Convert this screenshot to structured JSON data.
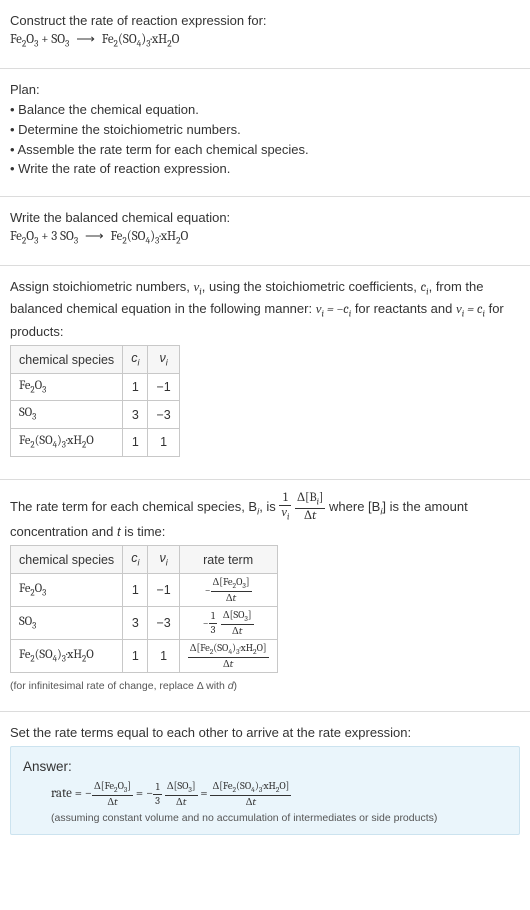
{
  "intro": {
    "prompt": "Construct the rate of reaction expression for:",
    "r_fe2o3": "Fe",
    "r_fe2o3_s1": "2",
    "r_fe2o3_s2": "O",
    "r_fe2o3_s3": "3",
    "r_so3": "SO",
    "r_so3_s": "3",
    "p_fe2so4": "Fe",
    "p_fe2so4_s1": "2",
    "p_fe2so4_s2": "(SO",
    "p_fe2so4_s3": "4",
    "p_fe2so4_s4": ")",
    "p_fe2so4_s5": "3",
    "p_fe2so4_s6": "·xH",
    "p_fe2so4_s7": "2",
    "p_fe2so4_s8": "O"
  },
  "plan": {
    "title": "Plan:",
    "b1": "Balance the chemical equation.",
    "b2": "Determine the stoichiometric numbers.",
    "b3": "Assemble the rate term for each chemical species.",
    "b4": "Write the rate of reaction expression."
  },
  "balanced": {
    "title": "Write the balanced chemical equation:",
    "c1": "Fe",
    "c1a": "2",
    "c1b": "O",
    "c1c": "3",
    "plus": " + 3 SO",
    "c2a": "3",
    "arrow_to": "Fe",
    "p1": "2",
    "p2": "(SO",
    "p3": "4",
    "p4": ")",
    "p5": "3",
    "p6": "·xH",
    "p7": "2",
    "p8": "O"
  },
  "assign": {
    "text_a": "Assign stoichiometric numbers, ",
    "text_b": ", using the stoichiometric coefficients, ",
    "text_c": ", from the balanced chemical equation in the following manner: ",
    "text_d": " for reactants and ",
    "text_e": " for products:",
    "nu": "ν",
    "nu_i": "i",
    "c": "c",
    "c_i": "i",
    "nu_eq_neg": "ν",
    "nu_eq_neg_i": "i",
    "nu_eq_neg_eq": " = −c",
    "nu_eq_neg_ci": "i",
    "nu_eq_pos": "ν",
    "nu_eq_pos_i": "i",
    "nu_eq_pos_eq": " = c",
    "nu_eq_pos_ci": "i"
  },
  "table1": {
    "h1": "chemical species",
    "h2": "c",
    "h2i": "i",
    "h3": "ν",
    "h3i": "i",
    "r1a": "Fe",
    "r1a1": "2",
    "r1a2": "O",
    "r1a3": "3",
    "r1b": "1",
    "r1c": "−1",
    "r2a": "SO",
    "r2a1": "3",
    "r2b": "3",
    "r2c": "−3",
    "r3a": "Fe",
    "r3a1": "2",
    "r3a2": "(SO",
    "r3a3": "4",
    "r3a4": ")",
    "r3a5": "3",
    "r3a6": "·xH",
    "r3a7": "2",
    "r3a8": "O",
    "r3b": "1",
    "r3c": "1"
  },
  "rate_text": {
    "a": "The rate term for each chemical species, B",
    "ai": "i",
    "b": ", is ",
    "c": " where [B",
    "ci": "i",
    "d": "] is the amount concentration and ",
    "t": "t",
    "e": " is time:",
    "f1n": "1",
    "f1d_nu": "ν",
    "f1d_i": "i",
    "f2n_d": "Δ[B",
    "f2n_i": "i",
    "f2n_end": "]",
    "f2d_d": "Δ",
    "f2d_t": "t"
  },
  "table2": {
    "h1": "chemical species",
    "h2": "c",
    "h2i": "i",
    "h3": "ν",
    "h3i": "i",
    "h4": "rate term",
    "r1a": "Fe",
    "r1a1": "2",
    "r1a2": "O",
    "r1a3": "3",
    "r1b": "1",
    "r1c": "−1",
    "r1d_n": "Δ[Fe",
    "r1d_n1": "2",
    "r1d_n2": "O",
    "r1d_n3": "3",
    "r1d_n4": "]",
    "r1d_d": "Δ",
    "r1d_dt": "t",
    "r1d_neg": "−",
    "r2a": "SO",
    "r2a1": "3",
    "r2b": "3",
    "r2c": "−3",
    "r2d_neg": "−",
    "r2d_f1n": "1",
    "r2d_f1d": "3",
    "r2d_f2n": "Δ[SO",
    "r2d_f2n1": "3",
    "r2d_f2n2": "]",
    "r2d_f2d": "Δ",
    "r2d_f2dt": "t",
    "r3a": "Fe",
    "r3a1": "2",
    "r3a2": "(SO",
    "r3a3": "4",
    "r3a4": ")",
    "r3a5": "3",
    "r3a6": "·xH",
    "r3a7": "2",
    "r3a8": "O",
    "r3b": "1",
    "r3c": "1",
    "r3d_n": "Δ[Fe",
    "r3d_n1": "2",
    "r3d_n2": "(SO",
    "r3d_n3": "4",
    "r3d_n4": ")",
    "r3d_n5": "3",
    "r3d_n6": "·xH",
    "r3d_n7": "2",
    "r3d_n8": "O]",
    "r3d_d": "Δ",
    "r3d_dt": "t"
  },
  "note1": "(for infinitesimal rate of change, replace Δ with ",
  "note1_d": "d",
  "note1_end": ")",
  "set_text": "Set the rate terms equal to each other to arrive at the rate expression:",
  "answer": {
    "title": "Answer:",
    "rate": "rate = −",
    "t1n": "Δ[Fe",
    "t1n1": "2",
    "t1n2": "O",
    "t1n3": "3",
    "t1n4": "]",
    "t1d": "Δ",
    "t1dt": "t",
    "eq1": " = −",
    "f3n": "1",
    "f3d": "3",
    "t2n": "Δ[SO",
    "t2n1": "3",
    "t2n2": "]",
    "t2d": "Δ",
    "t2dt": "t",
    "eq2": " = ",
    "t3n": "Δ[Fe",
    "t3n1": "2",
    "t3n2": "(SO",
    "t3n3": "4",
    "t3n4": ")",
    "t3n5": "3",
    "t3n6": "·xH",
    "t3n7": "2",
    "t3n8": "O]",
    "t3d": "Δ",
    "t3dt": "t",
    "note": "(assuming constant volume and no accumulation of intermediates or side products)"
  }
}
